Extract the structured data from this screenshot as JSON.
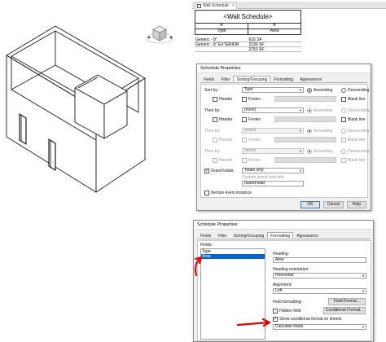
{
  "view_tab": {
    "label": "Wall Schedule",
    "close": "×"
  },
  "schedule": {
    "title": "<Wall Schedule>",
    "columns": [
      {
        "letter": "A",
        "name": "Type"
      },
      {
        "letter": "B",
        "name": "Area"
      }
    ],
    "rows": [
      {
        "type": "Generic - 8\"",
        "area": "616 SF"
      },
      {
        "type": "Generic - 8\" EXTERIOR",
        "area": "2236 SF"
      }
    ],
    "grand_total": "2753 SF"
  },
  "dialog1": {
    "title": "Schedule Properties",
    "tabs": [
      "Fields",
      "Filter",
      "Sorting/Grouping",
      "Formatting",
      "Appearance"
    ],
    "active_tab": "Sorting/Grouping",
    "sort_by_label": "Sort by:",
    "then_by_label": "Then by:",
    "header_label": "Header",
    "footer_label": "Footer:",
    "ascending_label": "Ascending",
    "descending_label": "Descending",
    "blank_line_label": "Blank line",
    "sort_by_value": "Type",
    "then_by_value": "(none)",
    "grand_totals_label": "Grand totals:",
    "grand_totals_value": "Totals only",
    "custom_title_label": "Custom grand total title:",
    "custom_title_value": "Grand total",
    "itemize_label": "Itemize every instance",
    "ok": "OK",
    "cancel": "Cancel",
    "help": "Help"
  },
  "dialog2": {
    "title": "Schedule Properties",
    "tabs": [
      "Fields",
      "Filter",
      "Sorting/Grouping",
      "Formatting",
      "Appearance"
    ],
    "active_tab": "Formatting",
    "fields_label": "Fields:",
    "fields": [
      "Type",
      "Area"
    ],
    "selected_field": "Area",
    "heading_label": "Heading:",
    "heading_value": "Area",
    "heading_orientation_label": "Heading orientation:",
    "heading_orientation_value": "Horizontal",
    "alignment_label": "Alignment:",
    "alignment_value": "Left",
    "field_formatting_label": "Field formatting:",
    "field_format_button": "Field Format...",
    "hidden_field_label": "Hidden field",
    "conditional_format_button": "Conditional Format...",
    "show_conditional_label": "Show conditional format on sheets",
    "calc_value": "Calculate totals"
  },
  "colors": {
    "accent": "#0a64c8",
    "annotation": "#e00000"
  }
}
